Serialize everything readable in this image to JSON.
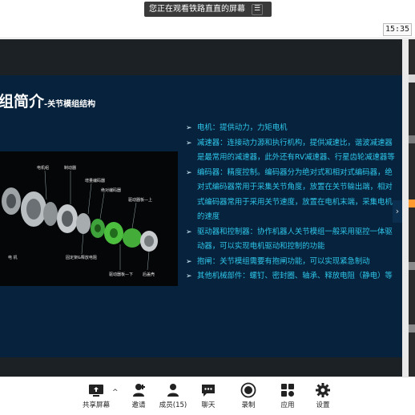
{
  "notice": {
    "text": "您正在观看铁路直直的屏幕",
    "menu_icon": "menu-icon"
  },
  "clock": {
    "time": "15:35"
  },
  "slide": {
    "title_main": "组简介",
    "title_sub": "-关节模组结构",
    "image_labels": [
      "电机组",
      "制动器",
      "增量编码器",
      "绝对编码器",
      "驱动器板—上",
      "电 机",
      "固定架&释放电阻",
      "驱动器板—下",
      "后盖壳"
    ],
    "bullets": [
      "电机：提供动力，力矩电机",
      "减速器：连接动力源和执行机构，提供减速比，谐波减速器是最常用的减速器，此外还有RV减速器、行星齿轮减速器等",
      "编码器：精度控制。编码器分为绝对式和相对式编码器，绝对式编码器常用于采集关节角度，放置在关节输出端，相对式编码器常用于采用关节速度，放置在电机末端，采集电机的速度",
      "驱动器和控制器：协作机器人关节模组一般采用驱控一体驱动器，可以实现电机驱动和控制的功能",
      "抱闸：关节模组需要有抱闸功能，可以实现紧急制动",
      "其他机械部件：螺钉、密封圈、轴承、释放电阻（静电）等"
    ],
    "bullet_marker": "➢",
    "next_arrow": "›"
  },
  "toolbar": {
    "share_label": "共享屏幕",
    "invite_label": "邀请",
    "members_label": "成员(15)",
    "chat_label": "聊天",
    "record_label": "录制",
    "apps_label": "应用",
    "settings_label": "设置",
    "caret": "^"
  }
}
